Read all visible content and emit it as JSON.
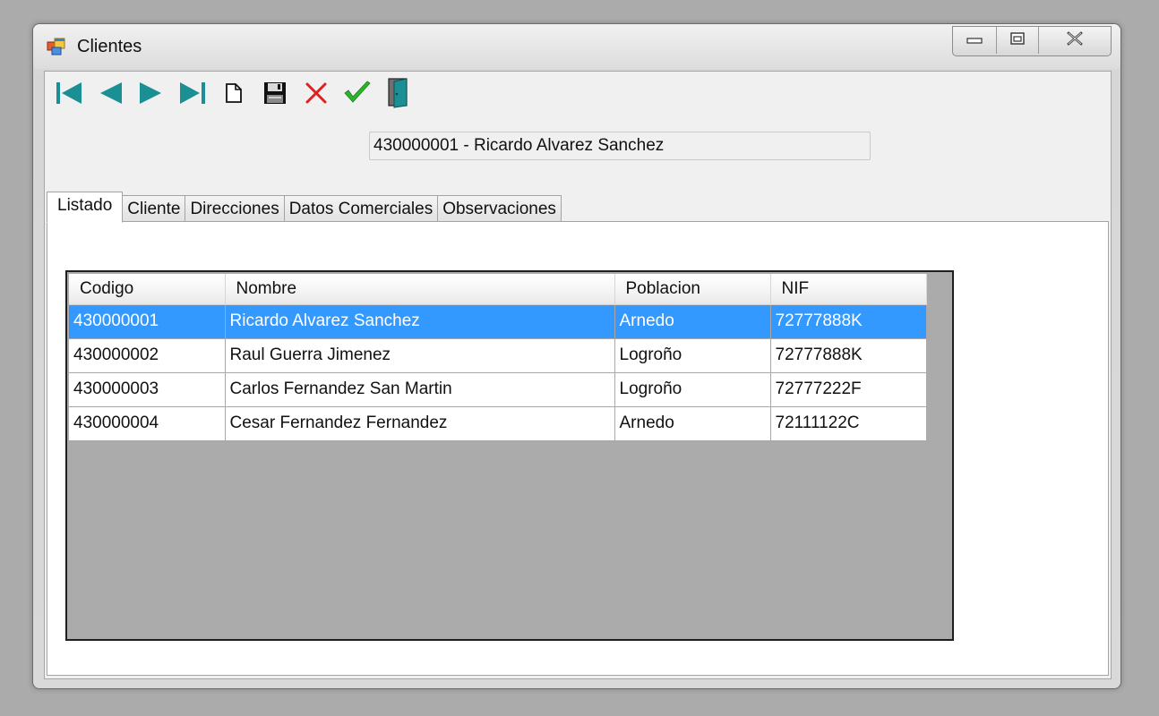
{
  "window": {
    "title": "Clientes",
    "icon": "app-window-icon",
    "caption_buttons": [
      "minimize-icon",
      "maximize-icon",
      "close-icon"
    ]
  },
  "toolbar": {
    "buttons": [
      {
        "name": "first-record-button",
        "icon": "first-record-icon"
      },
      {
        "name": "previous-record-button",
        "icon": "previous-record-icon"
      },
      {
        "name": "next-record-button",
        "icon": "next-record-icon"
      },
      {
        "name": "last-record-button",
        "icon": "last-record-icon"
      },
      {
        "name": "new-record-button",
        "icon": "new-document-icon"
      },
      {
        "name": "save-button",
        "icon": "floppy-disk-icon"
      },
      {
        "name": "delete-button",
        "icon": "red-x-icon"
      },
      {
        "name": "accept-button",
        "icon": "green-check-icon"
      },
      {
        "name": "exit-button",
        "icon": "exit-door-icon"
      }
    ],
    "colors": {
      "navigation": "#1a8f94",
      "delete": "#e02020",
      "accept": "#2bb52b"
    }
  },
  "header": {
    "current_record": "430000001 - Ricardo Alvarez Sanchez"
  },
  "tabs": [
    {
      "label": "Listado",
      "active": true
    },
    {
      "label": "Cliente",
      "active": false
    },
    {
      "label": "Direcciones",
      "active": false
    },
    {
      "label": "Datos Comerciales",
      "active": false
    },
    {
      "label": "Observaciones",
      "active": false
    }
  ],
  "grid": {
    "columns": [
      "Codigo",
      "Nombre",
      "Poblacion",
      "NIF"
    ],
    "rows": [
      {
        "codigo": "430000001",
        "nombre": "Ricardo Alvarez Sanchez",
        "poblacion": "Arnedo",
        "nif": "72777888K",
        "selected": true
      },
      {
        "codigo": "430000002",
        "nombre": "Raul Guerra Jimenez",
        "poblacion": "Logroño",
        "nif": "72777888K",
        "selected": false
      },
      {
        "codigo": "430000003",
        "nombre": "Carlos Fernandez San Martin",
        "poblacion": "Logroño",
        "nif": "72777222F",
        "selected": false
      },
      {
        "codigo": "430000004",
        "nombre": "Cesar Fernandez Fernandez",
        "poblacion": "Arnedo",
        "nif": "72111122C",
        "selected": false
      }
    ],
    "selection_color": "#3399ff"
  }
}
